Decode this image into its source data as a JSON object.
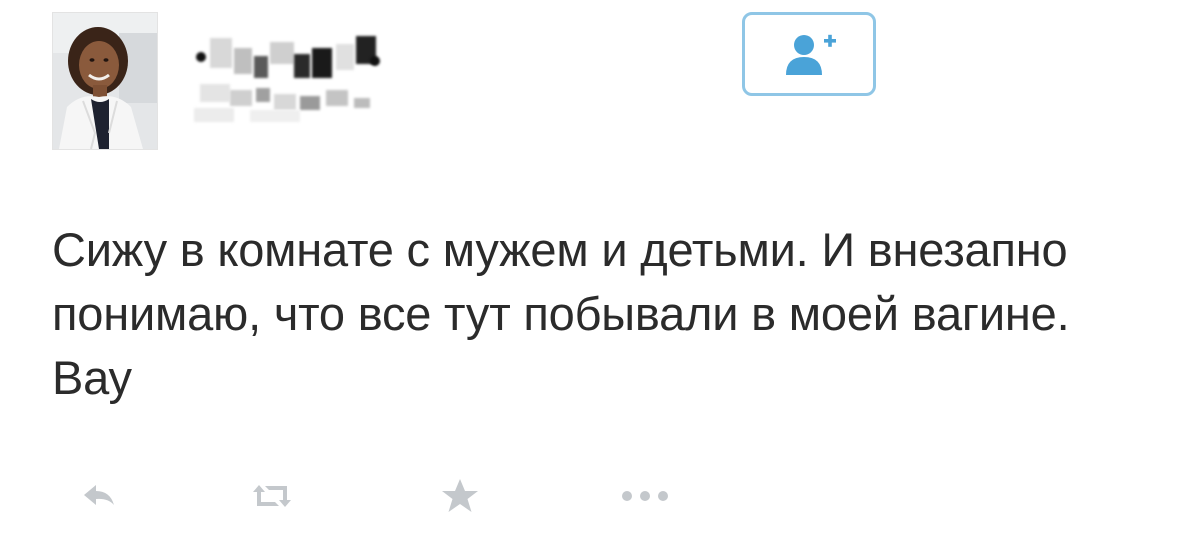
{
  "tweet": {
    "text": "Сижу в комнате с мужем и детьми. И внезапно понимаю, что все тут побывали в моей вагине. Вау"
  },
  "user": {
    "name_obscured": true
  },
  "actions": {
    "reply_icon": "reply-icon",
    "retweet_icon": "retweet-icon",
    "favorite_icon": "star-icon",
    "more_icon": "ellipsis-icon",
    "follow_icon": "follow-person-plus-icon"
  },
  "colors": {
    "text": "#2b2b2b",
    "follow_accent": "#4aa3d8",
    "follow_border": "#8fc6e6",
    "action_icon": "#c4c8cc"
  }
}
